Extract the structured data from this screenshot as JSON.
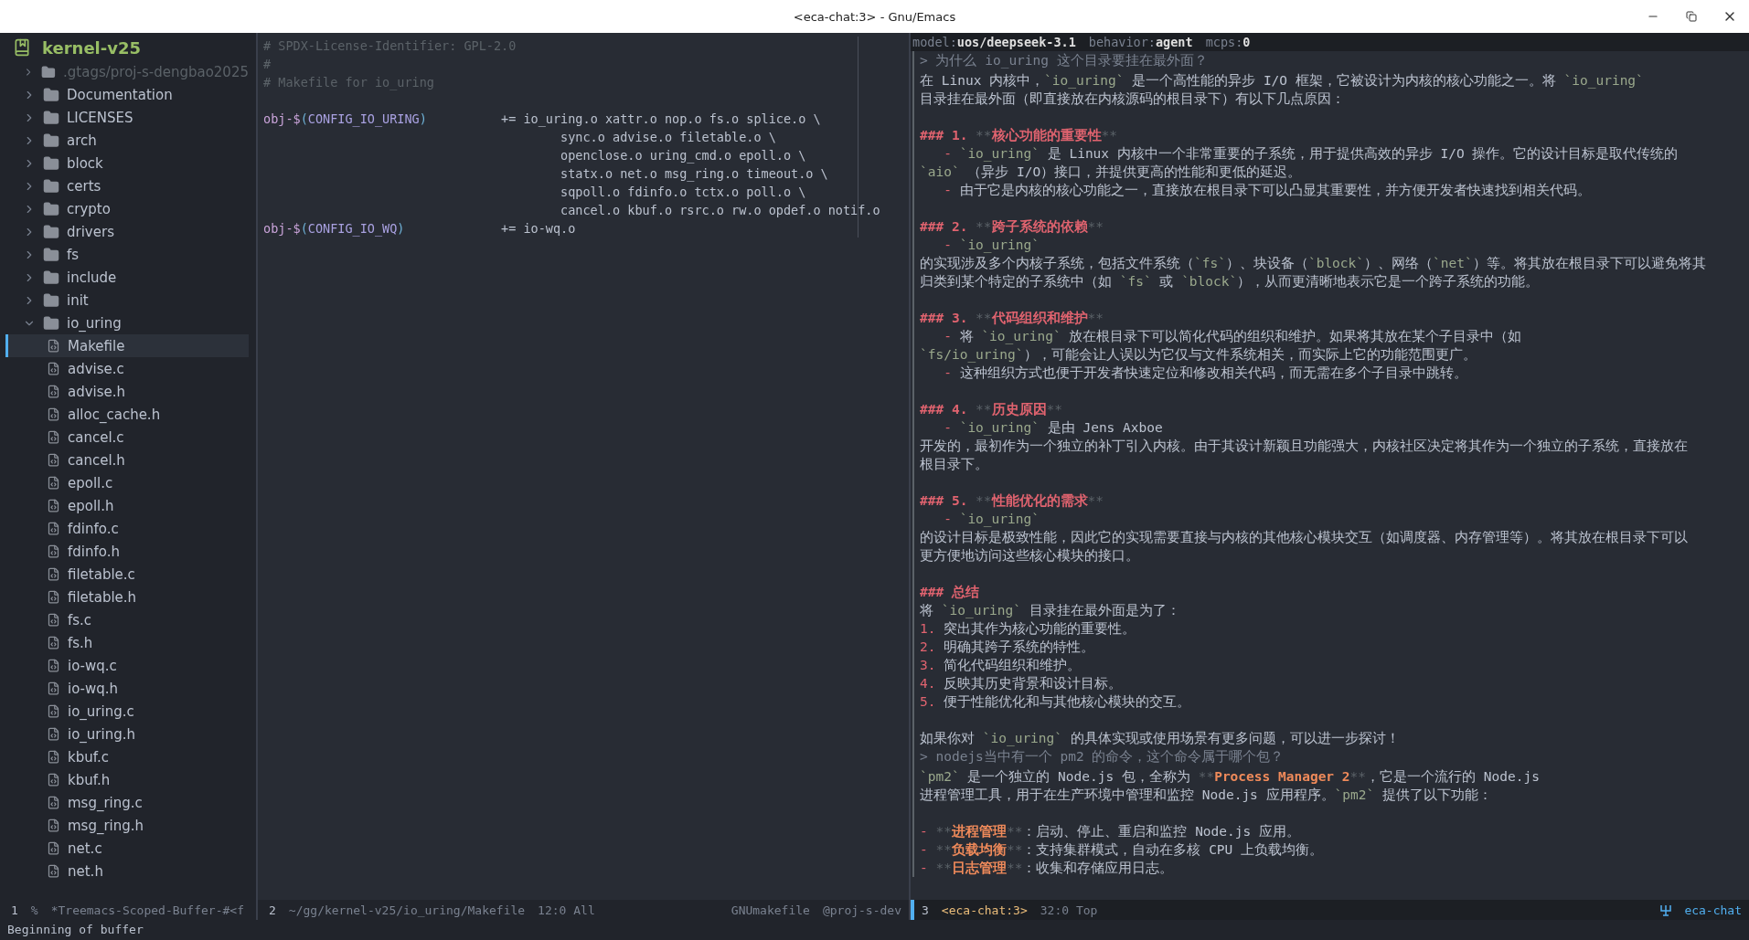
{
  "window": {
    "title": "<eca-chat:3> - Gnu/Emacs"
  },
  "sidebar": {
    "title": "kernel-v25",
    "items": [
      {
        "kind": "folder",
        "label": ".gtags/proj-s-dengbao2025",
        "expanded": false,
        "dimmed": true,
        "selected": false
      },
      {
        "kind": "folder",
        "label": "Documentation",
        "expanded": false,
        "dimmed": false,
        "selected": false
      },
      {
        "kind": "folder",
        "label": "LICENSES",
        "expanded": false,
        "dimmed": false,
        "selected": false
      },
      {
        "kind": "folder",
        "label": "arch",
        "expanded": false,
        "dimmed": false,
        "selected": false
      },
      {
        "kind": "folder",
        "label": "block",
        "expanded": false,
        "dimmed": false,
        "selected": false
      },
      {
        "kind": "folder",
        "label": "certs",
        "expanded": false,
        "dimmed": false,
        "selected": false
      },
      {
        "kind": "folder",
        "label": "crypto",
        "expanded": false,
        "dimmed": false,
        "selected": false
      },
      {
        "kind": "folder",
        "label": "drivers",
        "expanded": false,
        "dimmed": false,
        "selected": false
      },
      {
        "kind": "folder",
        "label": "fs",
        "expanded": false,
        "dimmed": false,
        "selected": false
      },
      {
        "kind": "folder",
        "label": "include",
        "expanded": false,
        "dimmed": false,
        "selected": false
      },
      {
        "kind": "folder",
        "label": "init",
        "expanded": false,
        "dimmed": false,
        "selected": false
      },
      {
        "kind": "folder",
        "label": "io_uring",
        "expanded": true,
        "dimmed": false,
        "selected": false,
        "children": [
          {
            "kind": "file",
            "label": "Makefile",
            "selected": true
          },
          {
            "kind": "file",
            "label": "advise.c",
            "selected": false
          },
          {
            "kind": "file",
            "label": "advise.h",
            "selected": false
          },
          {
            "kind": "file",
            "label": "alloc_cache.h",
            "selected": false
          },
          {
            "kind": "file",
            "label": "cancel.c",
            "selected": false
          },
          {
            "kind": "file",
            "label": "cancel.h",
            "selected": false
          },
          {
            "kind": "file",
            "label": "epoll.c",
            "selected": false
          },
          {
            "kind": "file",
            "label": "epoll.h",
            "selected": false
          },
          {
            "kind": "file",
            "label": "fdinfo.c",
            "selected": false
          },
          {
            "kind": "file",
            "label": "fdinfo.h",
            "selected": false
          },
          {
            "kind": "file",
            "label": "filetable.c",
            "selected": false
          },
          {
            "kind": "file",
            "label": "filetable.h",
            "selected": false
          },
          {
            "kind": "file",
            "label": "fs.c",
            "selected": false
          },
          {
            "kind": "file",
            "label": "fs.h",
            "selected": false
          },
          {
            "kind": "file",
            "label": "io-wq.c",
            "selected": false
          },
          {
            "kind": "file",
            "label": "io-wq.h",
            "selected": false
          },
          {
            "kind": "file",
            "label": "io_uring.c",
            "selected": false
          },
          {
            "kind": "file",
            "label": "io_uring.h",
            "selected": false
          },
          {
            "kind": "file",
            "label": "kbuf.c",
            "selected": false
          },
          {
            "kind": "file",
            "label": "kbuf.h",
            "selected": false
          },
          {
            "kind": "file",
            "label": "msg_ring.c",
            "selected": false
          },
          {
            "kind": "file",
            "label": "msg_ring.h",
            "selected": false
          },
          {
            "kind": "file",
            "label": "net.c",
            "selected": false
          },
          {
            "kind": "file",
            "label": "net.h",
            "selected": false
          }
        ]
      }
    ]
  },
  "editor": {
    "lines": [
      {
        "kind": "code",
        "segments": [
          {
            "t": "# SPDX-License-Identifier: GPL-2.0",
            "kind": "comment"
          }
        ]
      },
      {
        "kind": "code",
        "segments": [
          {
            "t": "#",
            "kind": "comment"
          }
        ]
      },
      {
        "kind": "code",
        "segments": [
          {
            "t": "# Makefile for io_uring",
            "kind": "comment"
          }
        ]
      },
      {
        "kind": "blank"
      },
      {
        "kind": "code",
        "segments": [
          {
            "t": "obj-$",
            "kind": "var"
          },
          {
            "t": "(",
            "kind": "paren"
          },
          {
            "t": "CONFIG_IO_URING",
            "kind": "name"
          },
          {
            "t": ")",
            "kind": "paren"
          },
          {
            "t": "\t\t+= io_uring.o xattr.o nop.o fs.o splice.o \\",
            "kind": "plain"
          }
        ]
      },
      {
        "kind": "code",
        "segments": [
          {
            "t": "\t\t\t\t\tsync.o advise.o filetable.o \\",
            "kind": "plain"
          }
        ]
      },
      {
        "kind": "code",
        "segments": [
          {
            "t": "\t\t\t\t\topenclose.o uring_cmd.o epoll.o \\",
            "kind": "plain"
          }
        ]
      },
      {
        "kind": "code",
        "segments": [
          {
            "t": "\t\t\t\t\tstatx.o net.o msg_ring.o timeout.o \\",
            "kind": "plain"
          }
        ]
      },
      {
        "kind": "code",
        "segments": [
          {
            "t": "\t\t\t\t\tsqpoll.o fdinfo.o tctx.o poll.o \\",
            "kind": "plain"
          }
        ]
      },
      {
        "kind": "code",
        "segments": [
          {
            "t": "\t\t\t\t\tcancel.o kbuf.o rsrc.o rw.o opdef.o notif.o",
            "kind": "plain"
          }
        ]
      },
      {
        "kind": "code",
        "segments": [
          {
            "t": "obj-$",
            "kind": "var"
          },
          {
            "t": "(",
            "kind": "paren"
          },
          {
            "t": "CONFIG_IO_WQ",
            "kind": "name"
          },
          {
            "t": ")",
            "kind": "paren"
          },
          {
            "t": "\t\t+= io-wq.o",
            "kind": "plain"
          }
        ]
      }
    ]
  },
  "chat": {
    "header": [
      {
        "label": "model:",
        "value": "uos/deepseek-3.1"
      },
      {
        "label": "behavior:",
        "value": "agent"
      },
      {
        "label": "mcps:",
        "value": "0"
      }
    ],
    "lines": [
      {
        "kind": "quote",
        "segments": [
          {
            "t": "> 为什么 io_uring 这个目录要挂在最外面？",
            "kind": "quote"
          }
        ]
      },
      {
        "kind": "text",
        "segments": [
          {
            "t": "在 Linux 内核中，",
            "kind": "plain"
          },
          {
            "t": "`io_uring`",
            "kind": "code"
          },
          {
            "t": " 是一个高性能的异步 I/O 框架，它被设计为内核的核心功能之一。将 ",
            "kind": "plain"
          },
          {
            "t": "`io_uring`",
            "kind": "code"
          }
        ]
      },
      {
        "kind": "text",
        "segments": [
          {
            "t": "目录挂在最外面（即直接放在内核源码的根目录下）有以下几点原因：",
            "kind": "plain"
          }
        ]
      },
      {
        "kind": "blank"
      },
      {
        "kind": "heading",
        "segments": [
          {
            "t": "### 1. ",
            "kind": "hash"
          },
          {
            "t": "**",
            "kind": "stars"
          },
          {
            "t": "核心功能的重要性",
            "kind": "hbold"
          },
          {
            "t": "**",
            "kind": "stars"
          }
        ]
      },
      {
        "kind": "text",
        "segments": [
          {
            "t": "   - ",
            "kind": "dash"
          },
          {
            "t": "`io_uring`",
            "kind": "code"
          },
          {
            "t": " 是 Linux 内核中一个非常重要的子系统，用于提供高效的异步 I/O 操作。它的设计目标是取代传统的",
            "kind": "plain"
          }
        ]
      },
      {
        "kind": "text",
        "segments": [
          {
            "t": "`aio`",
            "kind": "code"
          },
          {
            "t": " （异步 I/O）接口，并提供更高的性能和更低的延迟。",
            "kind": "plain"
          }
        ]
      },
      {
        "kind": "text",
        "segments": [
          {
            "t": "   - ",
            "kind": "dash"
          },
          {
            "t": "由于它是内核的核心功能之一，直接放在根目录下可以凸显其重要性，并方便开发者快速找到相关代码。",
            "kind": "plain"
          }
        ]
      },
      {
        "kind": "blank"
      },
      {
        "kind": "heading",
        "segments": [
          {
            "t": "### 2. ",
            "kind": "hash"
          },
          {
            "t": "**",
            "kind": "stars"
          },
          {
            "t": "跨子系统的依赖",
            "kind": "hbold"
          },
          {
            "t": "**",
            "kind": "stars"
          }
        ]
      },
      {
        "kind": "text",
        "segments": [
          {
            "t": "   - ",
            "kind": "dash"
          },
          {
            "t": "`io_uring`",
            "kind": "code"
          }
        ]
      },
      {
        "kind": "text",
        "segments": [
          {
            "t": "的实现涉及多个内核子系统，包括文件系统（",
            "kind": "plain"
          },
          {
            "t": "`fs`",
            "kind": "code"
          },
          {
            "t": "）、块设备（",
            "kind": "plain"
          },
          {
            "t": "`block`",
            "kind": "code"
          },
          {
            "t": "）、网络（",
            "kind": "plain"
          },
          {
            "t": "`net`",
            "kind": "code"
          },
          {
            "t": "）等。将其放在根目录下可以避免将其",
            "kind": "plain"
          }
        ]
      },
      {
        "kind": "text",
        "segments": [
          {
            "t": "归类到某个特定的子系统中（如 ",
            "kind": "plain"
          },
          {
            "t": "`fs`",
            "kind": "code"
          },
          {
            "t": " 或 ",
            "kind": "plain"
          },
          {
            "t": "`block`",
            "kind": "code"
          },
          {
            "t": "），从而更清晰地表示它是一个跨子系统的功能。",
            "kind": "plain"
          }
        ]
      },
      {
        "kind": "blank"
      },
      {
        "kind": "heading",
        "segments": [
          {
            "t": "### 3. ",
            "kind": "hash"
          },
          {
            "t": "**",
            "kind": "stars"
          },
          {
            "t": "代码组织和维护",
            "kind": "hbold"
          },
          {
            "t": "**",
            "kind": "stars"
          }
        ]
      },
      {
        "kind": "text",
        "segments": [
          {
            "t": "   - ",
            "kind": "dash"
          },
          {
            "t": "将 ",
            "kind": "plain"
          },
          {
            "t": "`io_uring`",
            "kind": "code"
          },
          {
            "t": " 放在根目录下可以简化代码的组织和维护。如果将其放在某个子目录中（如",
            "kind": "plain"
          }
        ]
      },
      {
        "kind": "text",
        "segments": [
          {
            "t": "`fs/io_uring`",
            "kind": "code"
          },
          {
            "t": "），可能会让人误以为它仅与文件系统相关，而实际上它的功能范围更广。",
            "kind": "plain"
          }
        ]
      },
      {
        "kind": "text",
        "segments": [
          {
            "t": "   - ",
            "kind": "dash"
          },
          {
            "t": "这种组织方式也便于开发者快速定位和修改相关代码，而无需在多个子目录中跳转。",
            "kind": "plain"
          }
        ]
      },
      {
        "kind": "blank"
      },
      {
        "kind": "heading",
        "segments": [
          {
            "t": "### 4. ",
            "kind": "hash"
          },
          {
            "t": "**",
            "kind": "stars"
          },
          {
            "t": "历史原因",
            "kind": "hbold"
          },
          {
            "t": "**",
            "kind": "stars"
          }
        ]
      },
      {
        "kind": "text",
        "segments": [
          {
            "t": "   - ",
            "kind": "dash"
          },
          {
            "t": "`io_uring`",
            "kind": "code"
          },
          {
            "t": " 是由 Jens Axboe",
            "kind": "plain"
          }
        ]
      },
      {
        "kind": "text",
        "segments": [
          {
            "t": "开发的，最初作为一个独立的补丁引入内核。由于其设计新颖且功能强大，内核社区决定将其作为一个独立的子系统，直接放在",
            "kind": "plain"
          }
        ]
      },
      {
        "kind": "text",
        "segments": [
          {
            "t": "根目录下。",
            "kind": "plain"
          }
        ]
      },
      {
        "kind": "blank"
      },
      {
        "kind": "heading",
        "segments": [
          {
            "t": "### 5. ",
            "kind": "hash"
          },
          {
            "t": "**",
            "kind": "stars"
          },
          {
            "t": "性能优化的需求",
            "kind": "hbold"
          },
          {
            "t": "**",
            "kind": "stars"
          }
        ]
      },
      {
        "kind": "text",
        "segments": [
          {
            "t": "   - ",
            "kind": "dash"
          },
          {
            "t": "`io_uring`",
            "kind": "code"
          }
        ]
      },
      {
        "kind": "text",
        "segments": [
          {
            "t": "的设计目标是极致性能，因此它的实现需要直接与内核的其他核心模块交互（如调度器、内存管理等）。将其放在根目录下可以",
            "kind": "plain"
          }
        ]
      },
      {
        "kind": "text",
        "segments": [
          {
            "t": "更方便地访问这些核心模块的接口。",
            "kind": "plain"
          }
        ]
      },
      {
        "kind": "blank"
      },
      {
        "kind": "heading",
        "segments": [
          {
            "t": "### ",
            "kind": "hash"
          },
          {
            "t": "总结",
            "kind": "hbold"
          }
        ]
      },
      {
        "kind": "text",
        "segments": [
          {
            "t": "将 ",
            "kind": "plain"
          },
          {
            "t": "`io_uring`",
            "kind": "code"
          },
          {
            "t": " 目录挂在最外面是为了：",
            "kind": "plain"
          }
        ]
      },
      {
        "kind": "text",
        "segments": [
          {
            "t": "1. ",
            "kind": "num"
          },
          {
            "t": "突出其作为核心功能的重要性。",
            "kind": "plain"
          }
        ]
      },
      {
        "kind": "text",
        "segments": [
          {
            "t": "2. ",
            "kind": "num"
          },
          {
            "t": "明确其跨子系统的特性。",
            "kind": "plain"
          }
        ]
      },
      {
        "kind": "text",
        "segments": [
          {
            "t": "3. ",
            "kind": "num"
          },
          {
            "t": "简化代码组织和维护。",
            "kind": "plain"
          }
        ]
      },
      {
        "kind": "text",
        "segments": [
          {
            "t": "4. ",
            "kind": "num"
          },
          {
            "t": "反映其历史背景和设计目标。",
            "kind": "plain"
          }
        ]
      },
      {
        "kind": "text",
        "segments": [
          {
            "t": "5. ",
            "kind": "num"
          },
          {
            "t": "便于性能优化和与其他核心模块的交互。",
            "kind": "plain"
          }
        ]
      },
      {
        "kind": "blank"
      },
      {
        "kind": "text",
        "segments": [
          {
            "t": "如果你对 ",
            "kind": "plain"
          },
          {
            "t": "`io_uring`",
            "kind": "code"
          },
          {
            "t": " 的具体实现或使用场景有更多问题，可以进一步探讨！",
            "kind": "plain"
          }
        ]
      },
      {
        "kind": "quote",
        "segments": [
          {
            "t": "> nodejs当中有一个 pm2 的命令，这个命令属于哪个包？",
            "kind": "quote"
          }
        ]
      },
      {
        "kind": "text",
        "segments": [
          {
            "t": "`pm2`",
            "kind": "code"
          },
          {
            "t": " 是一个独立的 Node.js 包，全称为 ",
            "kind": "plain"
          },
          {
            "t": "**",
            "kind": "stars"
          },
          {
            "t": "Process Manager 2",
            "kind": "bold"
          },
          {
            "t": "**",
            "kind": "stars"
          },
          {
            "t": "，它是一个流行的 Node.js",
            "kind": "plain"
          }
        ]
      },
      {
        "kind": "text",
        "segments": [
          {
            "t": "进程管理工具，用于在生产环境中管理和监控 Node.js 应用程序。",
            "kind": "plain"
          },
          {
            "t": "`pm2`",
            "kind": "code"
          },
          {
            "t": " 提供了以下功能：",
            "kind": "plain"
          }
        ]
      },
      {
        "kind": "blank"
      },
      {
        "kind": "text",
        "segments": [
          {
            "t": "- ",
            "kind": "dash"
          },
          {
            "t": "**",
            "kind": "stars"
          },
          {
            "t": "进程管理",
            "kind": "bold"
          },
          {
            "t": "**",
            "kind": "stars"
          },
          {
            "t": "：启动、停止、重启和监控 Node.js 应用。",
            "kind": "plain"
          }
        ]
      },
      {
        "kind": "text",
        "segments": [
          {
            "t": "- ",
            "kind": "dash"
          },
          {
            "t": "**",
            "kind": "stars"
          },
          {
            "t": "负载均衡",
            "kind": "bold"
          },
          {
            "t": "**",
            "kind": "stars"
          },
          {
            "t": "：支持集群模式，自动在多核 CPU 上负载均衡。",
            "kind": "plain"
          }
        ]
      },
      {
        "kind": "text",
        "segments": [
          {
            "t": "- ",
            "kind": "dash"
          },
          {
            "t": "**",
            "kind": "stars"
          },
          {
            "t": "日志管理",
            "kind": "bold"
          },
          {
            "t": "**",
            "kind": "stars"
          },
          {
            "t": "：收集和存储应用日志。",
            "kind": "plain"
          }
        ]
      }
    ]
  },
  "mode_lines": [
    {
      "active": false,
      "segments": [
        {
          "kind": "number",
          "t": "1"
        },
        {
          "kind": "flag",
          "t": "%"
        },
        {
          "kind": "buffer",
          "t": "*Treemacs-Scoped-Buffer-#<f"
        }
      ]
    },
    {
      "active": false,
      "segments": [
        {
          "kind": "number",
          "t": "2"
        },
        {
          "kind": "buffer",
          "t": "~/gg/kernel-v25/io_uring/Makefile"
        },
        {
          "kind": "position",
          "t": "12:0 All"
        },
        {
          "kind": "spacer"
        },
        {
          "kind": "mode",
          "t": "GNUmakefile"
        },
        {
          "kind": "project",
          "t": "@proj-s-dev"
        }
      ]
    },
    {
      "active": true,
      "segments": [
        {
          "kind": "number",
          "t": "3"
        },
        {
          "kind": "buffer",
          "t": "<eca-chat:3>"
        },
        {
          "kind": "position",
          "t": "32:0 Top"
        },
        {
          "kind": "spacer"
        },
        {
          "kind": "icon"
        },
        {
          "kind": "mode",
          "t": "eca-chat"
        }
      ]
    }
  ],
  "echo_area": "Beginning of buffer"
}
